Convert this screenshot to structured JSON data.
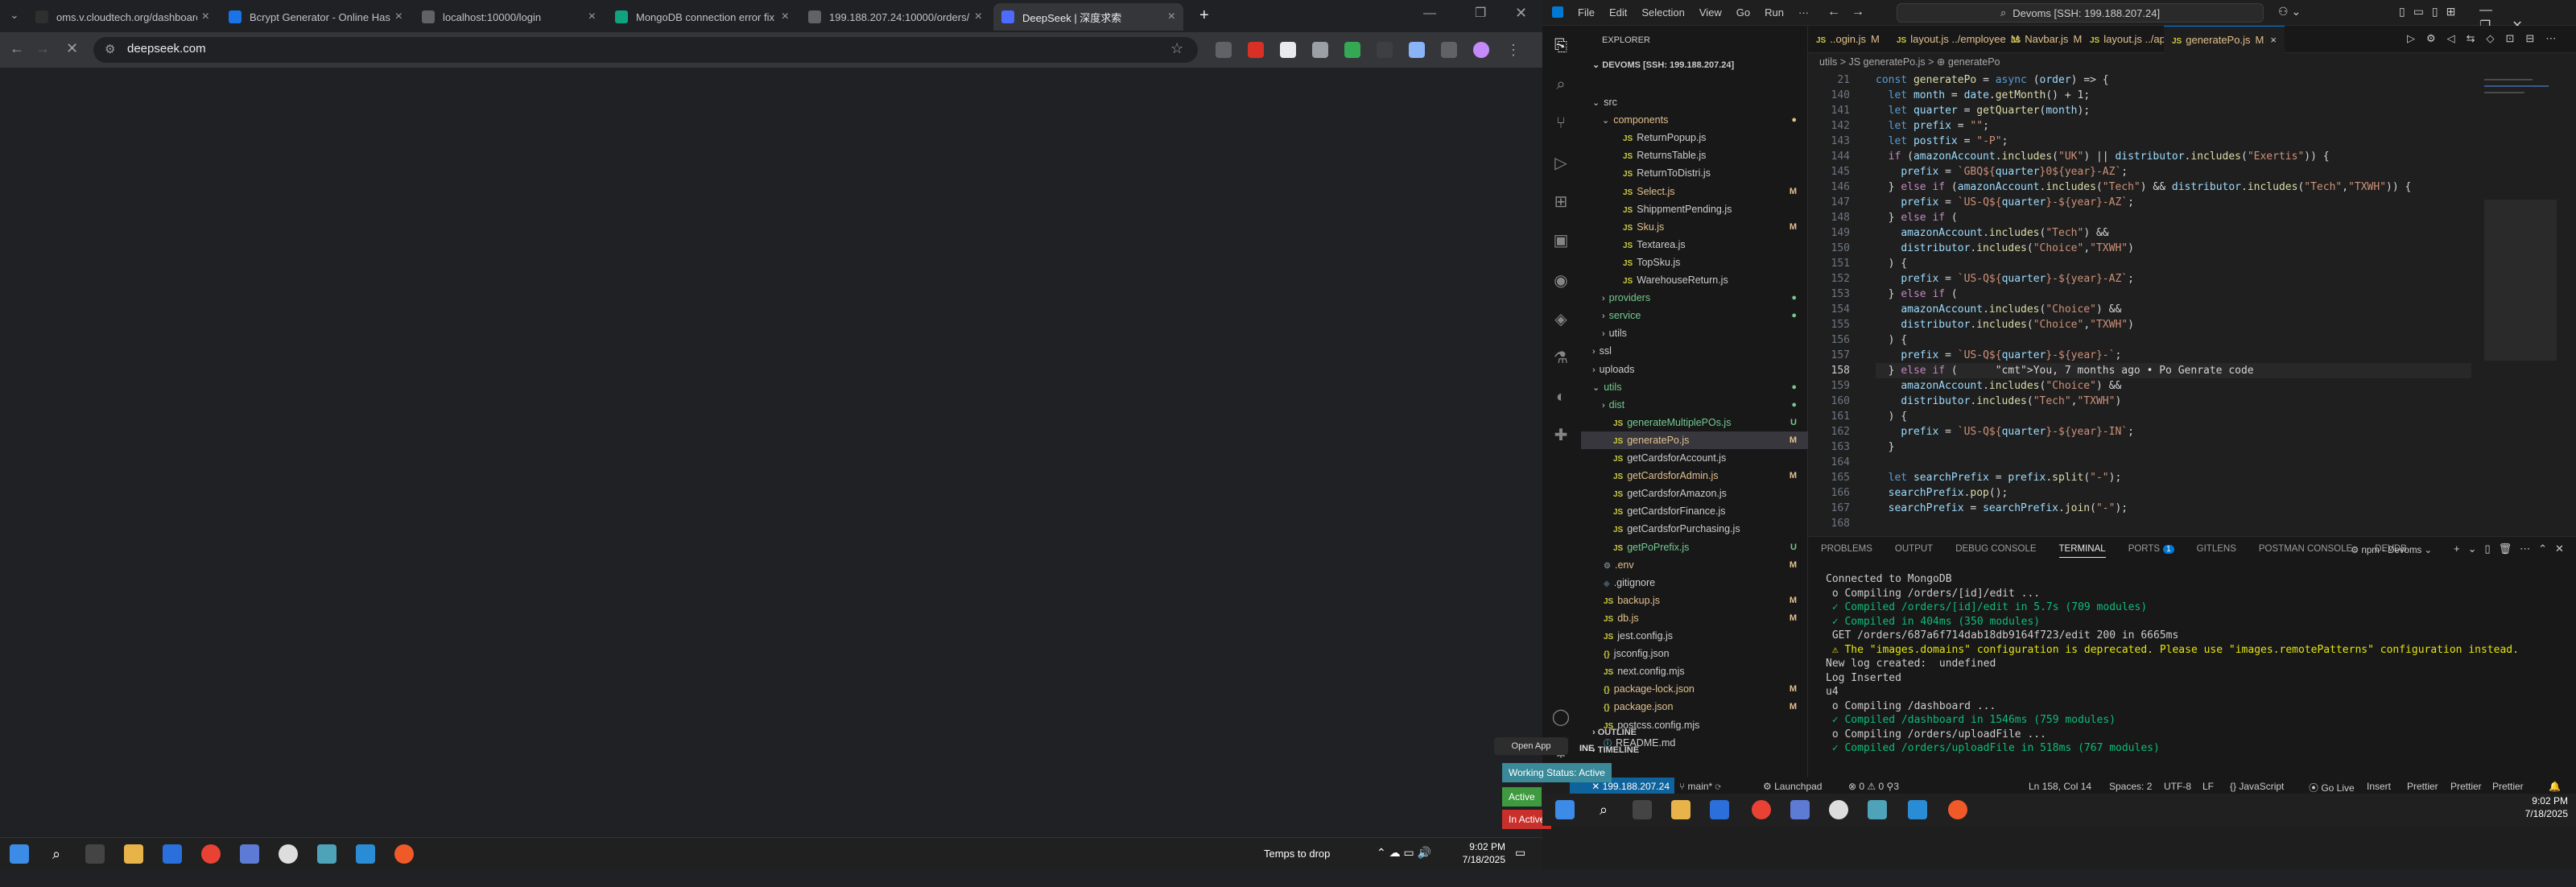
{
  "chrome": {
    "tabs": [
      {
        "title": "oms.v.cloudtech.org/dashboard",
        "color": "#2f2f2f"
      },
      {
        "title": "Bcrypt Generator - Online Hash",
        "color": "#1a73e8"
      },
      {
        "title": "localhost:10000/login",
        "color": "#5f6368"
      },
      {
        "title": "MongoDB connection error fix",
        "color": "#10a37f"
      },
      {
        "title": "199.188.207.24:10000/orders/u",
        "color": "#5f6368"
      },
      {
        "title": "DeepSeek | 深度求索",
        "color": "#4d6bfe"
      }
    ],
    "url": "deepseek.com"
  },
  "vscode": {
    "menu": [
      "File",
      "Edit",
      "Selection",
      "View",
      "Go",
      "Run",
      "···"
    ],
    "search": "Devoms [SSH: 199.188.207.24]",
    "explorer_title": "EXPLORER",
    "root": "DEVOMS [SSH: 199.188.207.24]",
    "tree": [
      {
        "label": "src",
        "indent": 0,
        "type": "folder",
        "open": true
      },
      {
        "label": "components",
        "indent": 1,
        "type": "folder",
        "open": true,
        "color": "#e2c08d"
      },
      {
        "label": "ReturnPopup.js",
        "indent": 2,
        "type": "js"
      },
      {
        "label": "ReturnsTable.js",
        "indent": 2,
        "type": "js"
      },
      {
        "label": "ReturnToDistri.js",
        "indent": 2,
        "type": "js"
      },
      {
        "label": "Select.js",
        "indent": 2,
        "type": "js",
        "dec": "M",
        "color": "#e2c08d"
      },
      {
        "label": "ShippmentPending.js",
        "indent": 2,
        "type": "js"
      },
      {
        "label": "Sku.js",
        "indent": 2,
        "type": "js",
        "dec": "M",
        "color": "#e2c08d"
      },
      {
        "label": "Textarea.js",
        "indent": 2,
        "type": "js"
      },
      {
        "label": "TopSku.js",
        "indent": 2,
        "type": "js"
      },
      {
        "label": "WarehouseReturn.js",
        "indent": 2,
        "type": "js"
      },
      {
        "label": "providers",
        "indent": 1,
        "type": "folder",
        "color": "#73c991"
      },
      {
        "label": "service",
        "indent": 1,
        "type": "folder",
        "color": "#73c991"
      },
      {
        "label": "utils",
        "indent": 1,
        "type": "folder"
      },
      {
        "label": "ssl",
        "indent": 0,
        "type": "folder"
      },
      {
        "label": "uploads",
        "indent": 0,
        "type": "folder"
      },
      {
        "label": "utils",
        "indent": 0,
        "type": "folder",
        "open": true,
        "color": "#73c991"
      },
      {
        "label": "dist",
        "indent": 1,
        "type": "folder",
        "color": "#73c991"
      },
      {
        "label": "generateMultiplePOs.js",
        "indent": 1,
        "type": "js",
        "dec": "U",
        "color": "#73c991"
      },
      {
        "label": "generatePo.js",
        "indent": 1,
        "type": "js",
        "dec": "M",
        "color": "#e2c08d",
        "selected": true
      },
      {
        "label": "getCardsforAccount.js",
        "indent": 1,
        "type": "js"
      },
      {
        "label": "getCardsforAdmin.js",
        "indent": 1,
        "type": "js",
        "dec": "M",
        "color": "#e2c08d"
      },
      {
        "label": "getCardsforAmazon.js",
        "indent": 1,
        "type": "js"
      },
      {
        "label": "getCardsforFinance.js",
        "indent": 1,
        "type": "js"
      },
      {
        "label": "getCardsforPurchasing.js",
        "indent": 1,
        "type": "js"
      },
      {
        "label": "getPoPrefix.js",
        "indent": 1,
        "type": "js",
        "dec": "U",
        "color": "#73c991"
      },
      {
        "label": ".env",
        "indent": 0,
        "type": "env",
        "dec": "M",
        "color": "#e2c08d"
      },
      {
        "label": ".gitignore",
        "indent": 0,
        "type": "git"
      },
      {
        "label": "backup.js",
        "indent": 0,
        "type": "js",
        "dec": "M",
        "color": "#e2c08d"
      },
      {
        "label": "db.js",
        "indent": 0,
        "type": "js",
        "dec": "M",
        "color": "#e2c08d"
      },
      {
        "label": "jest.config.js",
        "indent": 0,
        "type": "js"
      },
      {
        "label": "jsconfig.json",
        "indent": 0,
        "type": "json"
      },
      {
        "label": "next.config.mjs",
        "indent": 0,
        "type": "js"
      },
      {
        "label": "package-lock.json",
        "indent": 0,
        "type": "json",
        "dec": "M",
        "color": "#e2c08d"
      },
      {
        "label": "package.json",
        "indent": 0,
        "type": "json",
        "dec": "M",
        "color": "#e2c08d"
      },
      {
        "label": "postcss.config.mjs",
        "indent": 0,
        "type": "js"
      },
      {
        "label": "README.md",
        "indent": 0,
        "type": "md"
      }
    ],
    "outline_label": "OUTLINE",
    "timeline_label": "TIMELINE",
    "editor_tabs": [
      {
        "label": "..ogin.js",
        "dec": "M"
      },
      {
        "label": "layout.js ../employee",
        "dec": "M"
      },
      {
        "label": "Navbar.js",
        "dec": "M"
      },
      {
        "label": "layout.js ../app",
        "dec": "M"
      },
      {
        "label": "generatePo.js",
        "dec": "M",
        "active": true
      }
    ],
    "breadcrumb": "utils > JS generatePo.js > ⊕ generatePo",
    "sticky_line": "21",
    "sticky_code": "const generatePo = async (order) => {",
    "code_lines": [
      {
        "n": "140",
        "t": "  let month = date.getMonth() + 1;"
      },
      {
        "n": "141",
        "t": "  let quarter = getQuarter(month);"
      },
      {
        "n": "142",
        "t": "  let prefix = \"\";"
      },
      {
        "n": "143",
        "t": "  let postfix = \"-P\";"
      },
      {
        "n": "144",
        "t": "  if (amazonAccount.includes(\"UK\") || distributor.includes(\"Exertis\")) {"
      },
      {
        "n": "145",
        "t": "    prefix = `GBQ${quarter}0${year}-AZ`;"
      },
      {
        "n": "146",
        "t": "  } else if (amazonAccount.includes(\"Tech\") && distributor.includes(\"Tech\",\"TXWH\")) {"
      },
      {
        "n": "147",
        "t": "    prefix = `US-Q${quarter}-${year}-AZ`;"
      },
      {
        "n": "148",
        "t": "  } else if ("
      },
      {
        "n": "149",
        "t": "    amazonAccount.includes(\"Tech\") &&"
      },
      {
        "n": "150",
        "t": "    distributor.includes(\"Choice\",\"TXWH\")"
      },
      {
        "n": "151",
        "t": "  ) {"
      },
      {
        "n": "152",
        "t": "    prefix = `US-Q${quarter}-${year}-AZ`;"
      },
      {
        "n": "153",
        "t": "  } else if ("
      },
      {
        "n": "154",
        "t": "    amazonAccount.includes(\"Choice\") &&"
      },
      {
        "n": "155",
        "t": "    distributor.includes(\"Choice\",\"TXWH\")"
      },
      {
        "n": "156",
        "t": "  ) {"
      },
      {
        "n": "157",
        "t": "    prefix = `US-Q${quarter}-${year}-`;"
      },
      {
        "n": "158",
        "t": "  } else if (      You, 7 months ago • Po Genrate code"
      },
      {
        "n": "159",
        "t": "    amazonAccount.includes(\"Choice\") &&"
      },
      {
        "n": "160",
        "t": "    distributor.includes(\"Tech\",\"TXWH\")"
      },
      {
        "n": "161",
        "t": "  ) {"
      },
      {
        "n": "162",
        "t": "    prefix = `US-Q${quarter}-${year}-IN`;"
      },
      {
        "n": "163",
        "t": "  }"
      },
      {
        "n": "164",
        "t": ""
      },
      {
        "n": "165",
        "t": "  let searchPrefix = prefix.split(\"-\");"
      },
      {
        "n": "166",
        "t": "  searchPrefix.pop();"
      },
      {
        "n": "167",
        "t": "  searchPrefix = searchPrefix.join(\"-\");"
      },
      {
        "n": "168",
        "t": ""
      }
    ],
    "panel_tabs": [
      "PROBLEMS",
      "OUTPUT",
      "DEBUG CONSOLE",
      "TERMINAL",
      "PORTS",
      "GITLENS",
      "POSTMAN CONSOLE",
      "DEVDB"
    ],
    "ports_badge": "1",
    "terminal_label": "npm - Devoms",
    "terminal_lines": [
      {
        "t": "Connected to MongoDB",
        "c": ""
      },
      {
        "t": " o Compiling /orders/[id]/edit ...",
        "c": ""
      },
      {
        "t": " ✓ Compiled /orders/[id]/edit in 5.7s (709 modules)",
        "c": "ok"
      },
      {
        "t": " ✓ Compiled in 404ms (350 modules)",
        "c": "ok"
      },
      {
        "t": " GET /orders/687a6f714dab18db9164f723/edit 200 in 6665ms",
        "c": ""
      },
      {
        "t": " ⚠ The \"images.domains\" configuration is deprecated. Please use \"images.remotePatterns\" configuration instead.",
        "c": "warn"
      },
      {
        "t": "New log created:  undefined",
        "c": ""
      },
      {
        "t": "Log Inserted",
        "c": ""
      },
      {
        "t": "u4",
        "c": ""
      },
      {
        "t": " o Compiling /dashboard ...",
        "c": ""
      },
      {
        "t": " ✓ Compiled /dashboard in 1546ms (759 modules)",
        "c": "ok"
      },
      {
        "t": " o Compiling /orders/uploadFile ...",
        "c": ""
      },
      {
        "t": " ✓ Compiled /orders/uploadFile in 518ms (767 modules)",
        "c": "ok"
      },
      {
        "t": "",
        "c": ""
      }
    ],
    "status": {
      "remote": "199.188.207.24",
      "branch": "main*",
      "launchpad": "Launchpad",
      "errors": "0",
      "warnings": "0",
      "ports": "3",
      "position": "Ln 158, Col 14",
      "spaces": "Spaces: 2",
      "encoding": "UTF-8",
      "eol": "LF",
      "lang": "{} JavaScript",
      "golive": "Go Live",
      "insert": "Insert",
      "prettier": "Prettier"
    }
  },
  "overlay": {
    "open_app": "Open App",
    "line_text": "INE",
    "working_status": "Working Status: Active",
    "active_label": "Active",
    "inactive_label": "In Active"
  },
  "taskbar": {
    "search_text": "Temps to drop",
    "time": "9:02 PM",
    "date": "7/18/2025"
  }
}
